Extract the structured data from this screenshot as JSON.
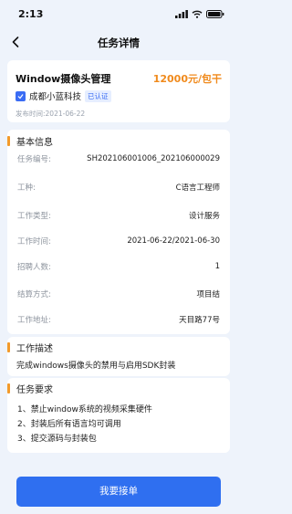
{
  "status": {
    "time": "2:13"
  },
  "nav": {
    "title": "任务详情"
  },
  "job": {
    "title": "Window摄像头管理",
    "salary": "12000元/包干",
    "company": "成都小蓝科技",
    "verified": "已认证",
    "published": "发布时间:2021-06-22"
  },
  "basic": {
    "title": "基本信息",
    "rows": [
      {
        "label": "任务编号:",
        "value": "SH202106001006_202106000029"
      },
      {
        "label": "工种:",
        "value": "C语言工程师"
      },
      {
        "label": "工作类型:",
        "value": "设计服务"
      },
      {
        "label": "工作时间:",
        "value": "2021-06-22/2021-06-30"
      },
      {
        "label": "招聘人数:",
        "value": "1"
      },
      {
        "label": "结算方式:",
        "value": "项目结"
      },
      {
        "label": "工作地址:",
        "value": "天目路77号"
      }
    ]
  },
  "description": {
    "title": "工作描述",
    "text": "完成windows摄像头的禁用与启用SDK封装"
  },
  "requirements": {
    "title": "任务要求",
    "items": [
      "1、禁止window系统的视频采集硬件",
      "2、封装后所有语言均可调用",
      "3、提交源码与封装包"
    ]
  },
  "accept_button": "我要接单"
}
